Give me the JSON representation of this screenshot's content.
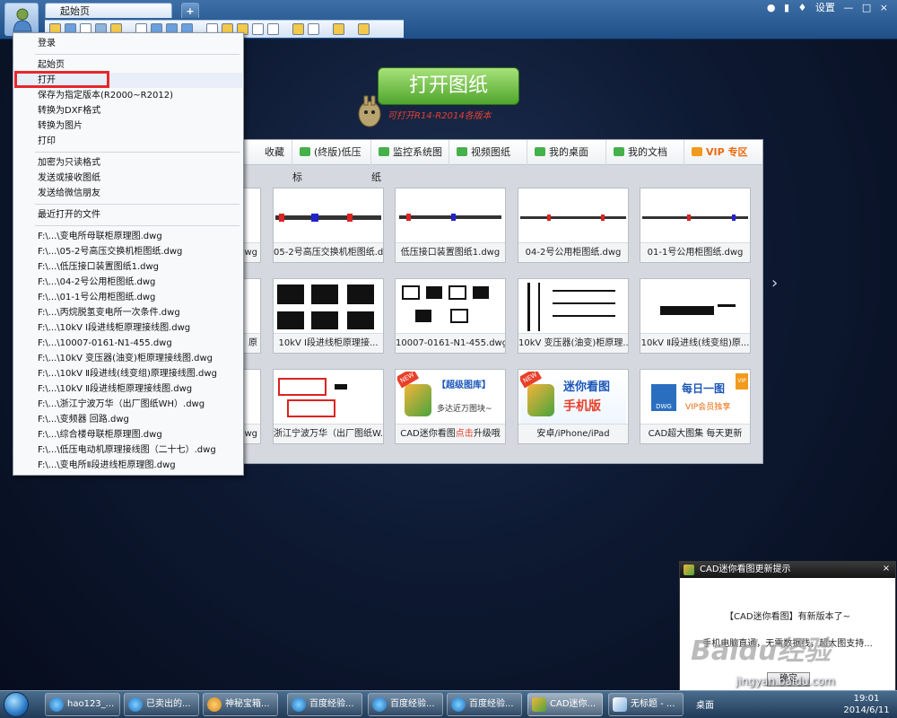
{
  "tabs": {
    "start": "起始页",
    "add": "+"
  },
  "topright": {
    "settings": "设置",
    "minimize": "—",
    "maximize": "□",
    "close": "×"
  },
  "main": {
    "open_button": "打开图纸",
    "version_note": "可打开R14-R2014各版本"
  },
  "categories": [
    {
      "label": "收藏",
      "color": "#f0a830"
    },
    {
      "label": "(终版)低压标",
      "color": "#46b04a"
    },
    {
      "label": "监控系统图纸",
      "color": "#46b04a"
    },
    {
      "label": "视频图纸",
      "color": "#46b04a"
    },
    {
      "label": "我的桌面",
      "color": "#46b04a"
    },
    {
      "label": "我的文档",
      "color": "#46b04a"
    },
    {
      "label": "VIP 专区",
      "color": "#f29a1e"
    }
  ],
  "cards": [
    {
      "caption": "05-2号高压交换机柜图纸.d..."
    },
    {
      "caption": "低压接口装置图纸1.dwg"
    },
    {
      "caption": "04-2号公用柜图纸.dwg"
    },
    {
      "caption": "01-1号公用柜图纸.dwg"
    },
    {
      "caption": "10kV Ⅰ段进线柜原理接..."
    },
    {
      "caption": "10007-0161-N1-455.dwg"
    },
    {
      "caption": "10kV 变压器(油变)柜原理..."
    },
    {
      "caption": "10kV Ⅱ段进线(线变组)原..."
    },
    {
      "caption": "浙江宁波万华（出厂图纸W..."
    },
    {
      "caption": "CAD迷你看图 点击升级哦"
    },
    {
      "caption": "安卓/iPhone/iPad"
    },
    {
      "caption": "CAD超大图集 每天更新"
    }
  ],
  "partial_captions": [
    "dwg",
    "原",
    "dwg"
  ],
  "promos": {
    "super_lib": "【超级图库】",
    "super_lib_sub": "多达近万图块~",
    "mini_title": "迷你看图",
    "mini_sub": "手机版",
    "daily_title": "每日一图",
    "daily_sub": "VIP会员独享",
    "new_badge": "NEW",
    "dwg_badge": "DWG",
    "vip_badge": "VIP",
    "cad_prefix": "CAD迷你看图",
    "cad_highlight": "点击",
    "cad_suffix": "升级哦"
  },
  "menu": {
    "items_top": [
      "登录",
      "起始页",
      "打开",
      "保存为指定版本(R2000~R2012)",
      "转换为DXF格式",
      "转换为图片",
      "打印"
    ],
    "items_mid": [
      "加密为只读格式",
      "发送或接收图纸",
      "发送给微信朋友"
    ],
    "recent_label": "最近打开的文件",
    "recent_files": [
      "F:\\...\\变电所母联柜原理图.dwg",
      "F:\\...\\05-2号高压交换机柜图纸.dwg",
      "F:\\...\\低压接口装置图纸1.dwg",
      "F:\\...\\04-2号公用柜图纸.dwg",
      "F:\\...\\01-1号公用柜图纸.dwg",
      "F:\\...\\丙烷脱氢变电所一次条件.dwg",
      "F:\\...\\10kV Ⅰ段进线柜原理接线图.dwg",
      "F:\\...\\10007-0161-N1-455.dwg",
      "F:\\...\\10kV 变压器(油变)柜原理接线图.dwg",
      "F:\\...\\10kV Ⅱ段进线(线变组)原理接线图.dwg",
      "F:\\...\\10kV Ⅱ段进线柜原理接线图.dwg",
      "F:\\...\\浙江宁波万华（出厂图纸WH）.dwg",
      "F:\\...\\变频器 回路.dwg",
      "F:\\...\\综合楼母联柜原理图.dwg",
      "F:\\...\\低压电动机原理接线图（二十七）.dwg",
      "F:\\...\\变电所Ⅱ段进线柜原理图.dwg"
    ]
  },
  "popup": {
    "title": "CAD迷你看图更新提示",
    "line1": "【CAD迷你看图】有新版本了~",
    "line2": "手机电脑直通，无需数据线，超大图支持...",
    "ok": "确定",
    "close": "×"
  },
  "watermark": {
    "text": "Baidu经验",
    "url": "jingyan.baidu.com"
  },
  "taskbar": {
    "tasks": [
      "hao123_...",
      "已卖出的...",
      "神秘宝箱...",
      "百度经验...",
      "百度经验...",
      "百度经验...",
      "CAD迷你...",
      "无标题 - ..."
    ],
    "tray_label": "桌面",
    "time": "19:01",
    "date": "2014/6/11"
  },
  "colors": {
    "highlight": "#e8262d",
    "accent_green": "#4fa52c",
    "vip": "#e96a0f"
  }
}
